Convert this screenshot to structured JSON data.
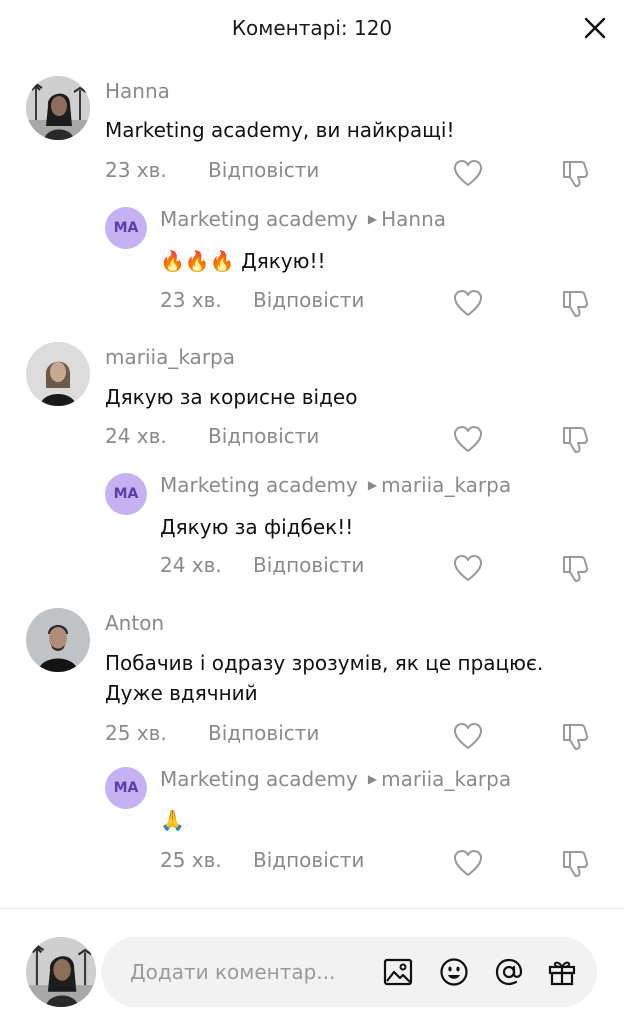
{
  "header": {
    "title": "Коментарі: 120"
  },
  "comments": [
    {
      "author": "Hanna",
      "text": "Marketing academy, ви найкращі!",
      "time": "23 хв.",
      "reply_label": "Відповісти",
      "reply": {
        "initials": "MA",
        "author": "Marketing academy",
        "to": "Hanna",
        "text": "🔥🔥🔥 Дякую!!",
        "time": "23 хв.",
        "reply_label": "Відповісти"
      }
    },
    {
      "author": "mariia_karpa",
      "text": "Дякую за корисне відео",
      "time": "24 хв.",
      "reply_label": "Відповісти",
      "reply": {
        "initials": "MA",
        "author": "Marketing academy",
        "to": "mariia_karpa",
        "text": "Дякую за фідбек!!",
        "time": "24 хв.",
        "reply_label": "Відповісти"
      }
    },
    {
      "author": "Anton",
      "text_line1": "Побачив і одразу зрозумів, як це працює.",
      "text_line2": "Дуже вдячний",
      "time": "25 хв.",
      "reply_label": "Відповісти",
      "reply": {
        "initials": "MA",
        "author": "Marketing academy",
        "to": "mariia_karpa",
        "text": "🙏",
        "time": "25 хв.",
        "reply_label": "Відповісти"
      }
    }
  ],
  "composer": {
    "placeholder": "Додати коментар..."
  },
  "icons": {
    "close": "close-icon",
    "like": "heart-icon",
    "dislike": "thumbs-down-icon",
    "image": "image-icon",
    "emoji": "emoji-icon",
    "mention": "at-sign-icon",
    "gift": "gift-icon"
  },
  "colors": {
    "badge_bg": "#c6b2f2",
    "badge_text": "#5a3fa8",
    "muted": "#8a8a8a",
    "input_bg": "#f2f2f2"
  }
}
